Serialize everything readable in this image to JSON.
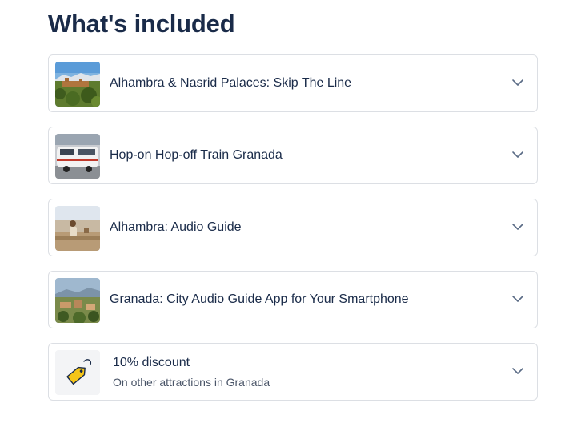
{
  "section": {
    "title": "What's included"
  },
  "items": [
    {
      "label": "Alhambra & Nasrid Palaces: Skip The Line",
      "icon": "alhambra-photo"
    },
    {
      "label": "Hop-on Hop-off Train Granada",
      "icon": "train-photo"
    },
    {
      "label": "Alhambra: Audio Guide",
      "icon": "audio-guide-photo"
    },
    {
      "label": "Granada: City Audio Guide App for Your Smartphone",
      "icon": "granada-city-photo"
    }
  ],
  "discount": {
    "label": "10% discount",
    "sublabel": "On other attractions in Granada",
    "icon": "price-tag-icon"
  },
  "colors": {
    "text": "#1a2b49",
    "border": "#dcdfe4",
    "tag": "#f5c518"
  }
}
